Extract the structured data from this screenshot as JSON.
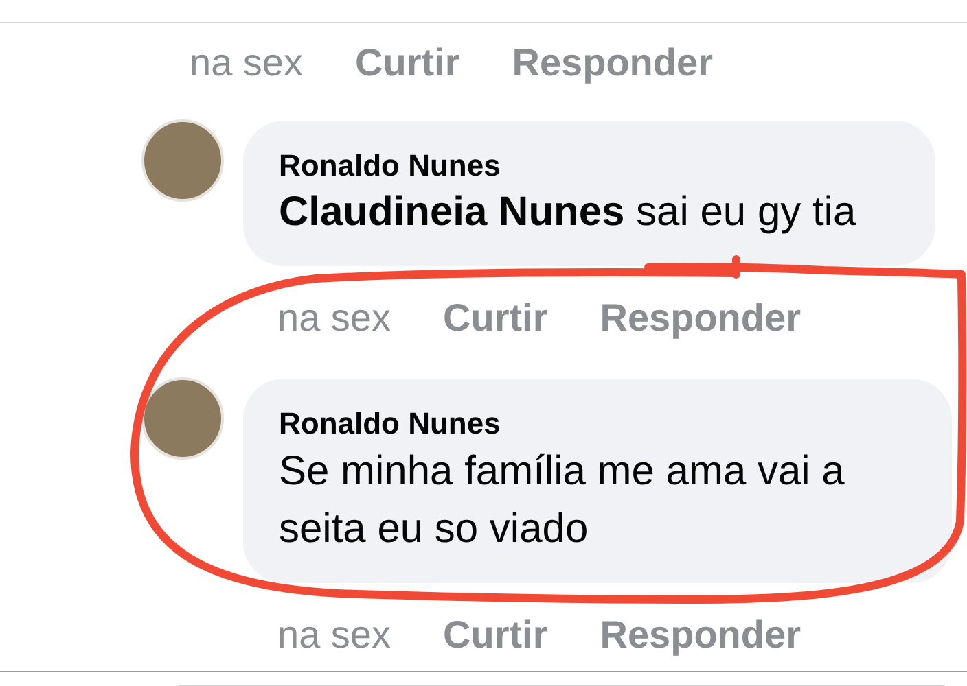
{
  "top_actions": {
    "time": "na sex",
    "like": "Curtir",
    "reply": "Responder"
  },
  "comments": [
    {
      "author": "Ronaldo Nunes",
      "text": "**Claudineia Nunes** sai eu gy tia",
      "actions": {
        "time": "na sex",
        "like": "Curtir",
        "reply": "Responder"
      }
    },
    {
      "author": "Ronaldo Nunes",
      "text": "Se minha família me ama vai a seita eu so viado",
      "actions": {
        "time": "na sex",
        "like": "Curtir",
        "reply": "Responder"
      }
    }
  ]
}
